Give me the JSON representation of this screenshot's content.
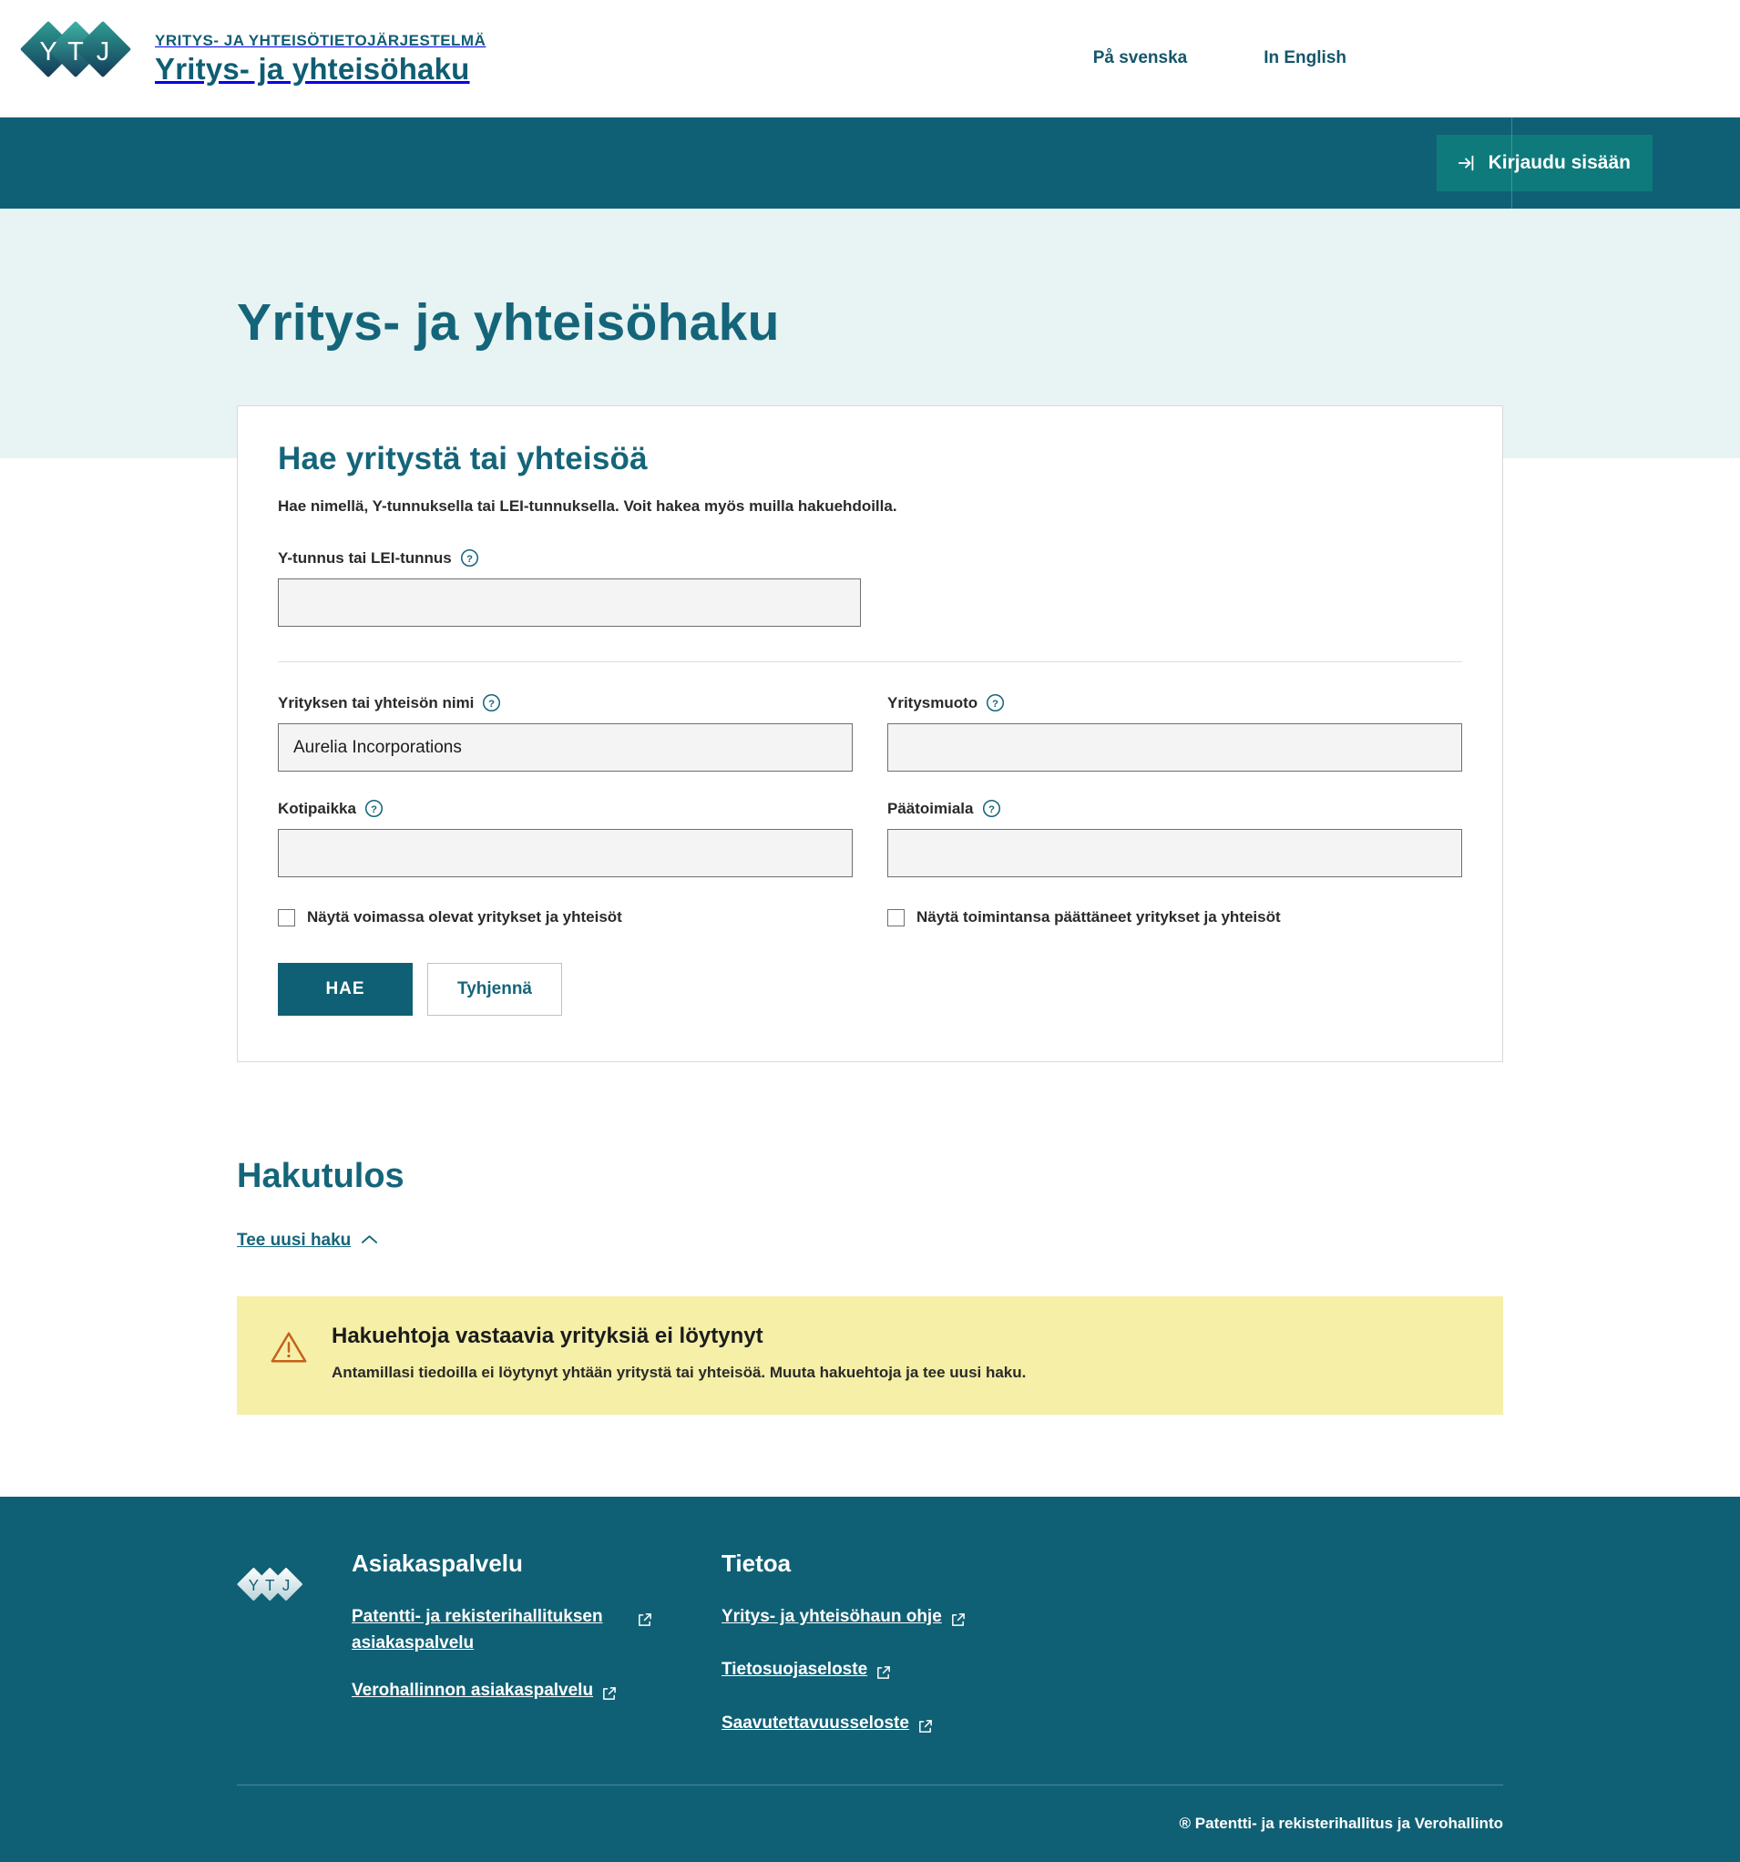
{
  "header": {
    "logo_letters": [
      "Y",
      "T",
      "J"
    ],
    "supertitle": "YRITYS- JA YHTEISÖTIETOJÄRJESTELMÄ",
    "title": "Yritys- ja yhteisöhaku",
    "lang_sv": "På svenska",
    "lang_en": "In English",
    "login_label": "Kirjaudu sisään",
    "login_icon": "login-arrow-icon",
    "accent_dark": "#106075",
    "accent_login": "#0e7a7c"
  },
  "hero": {
    "page_title": "Yritys- ja yhteisöhaku",
    "background": "#e7f4f3"
  },
  "search_card": {
    "title": "Hae yritystä tai yhteisöä",
    "subtitle": "Hae nimellä, Y-tunnuksella tai LEI-tunnuksella. Voit hakea myös muilla hakuehdoilla.",
    "fields": {
      "business_id": {
        "label": "Y-tunnus tai LEI-tunnus",
        "value": "",
        "placeholder": "",
        "help_icon": "help-circle-icon"
      },
      "name": {
        "label": "Yrityksen tai yhteisön nimi",
        "value": "Aurelia Incorporations",
        "placeholder": "",
        "help_icon": "help-circle-icon"
      },
      "company_form": {
        "label": "Yritysmuoto",
        "value": "",
        "placeholder": "",
        "help_icon": "help-circle-icon"
      },
      "domicile": {
        "label": "Kotipaikka",
        "value": "",
        "placeholder": "",
        "help_icon": "help-circle-icon"
      },
      "industry": {
        "label": "Päätoimiala",
        "value": "",
        "placeholder": "",
        "help_icon": "help-circle-icon"
      }
    },
    "checkboxes": [
      {
        "label": "Näytä voimassa olevat yritykset ja yhteisöt",
        "checked": false
      },
      {
        "label": "Näytä toimintansa päättäneet yritykset ja yhteisöt",
        "checked": false
      }
    ],
    "submit_label": "HAE",
    "clear_label": "Tyhjennä"
  },
  "results": {
    "title": "Hakutulos",
    "new_search_label": "Tee uusi haku",
    "new_search_icon": "chevron-up-icon",
    "alert": {
      "icon": "warning-triangle-icon",
      "title": "Hakuehtoja vastaavia yrityksiä ei löytynyt",
      "body": "Antamillasi tiedoilla ei löytynyt yhtään yritystä tai yhteisöä. Muuta hakuehtoja ja tee uusi haku.",
      "background": "#f5efa8",
      "icon_color": "#c4621a"
    }
  },
  "footer": {
    "logo_icon": "ytj-logo-icon",
    "columns": [
      {
        "heading": "Asiakaspalvelu",
        "links": [
          {
            "label": "Patentti- ja rekisterihallituksen asiakaspalvelu",
            "icon": "external-link-icon"
          },
          {
            "label": "Verohallinnon asiakaspalvelu",
            "icon": "external-link-icon"
          }
        ]
      },
      {
        "heading": "Tietoa",
        "links": [
          {
            "label": "Yritys- ja yhteisöhaun ohje",
            "icon": "external-link-icon"
          },
          {
            "label": "Tietosuojaseloste",
            "icon": "external-link-icon"
          },
          {
            "label": "Saavutettavuusseloste",
            "icon": "external-link-icon"
          }
        ]
      }
    ],
    "copyright": "® Patentti- ja rekisterihallitus ja Verohallinto"
  }
}
